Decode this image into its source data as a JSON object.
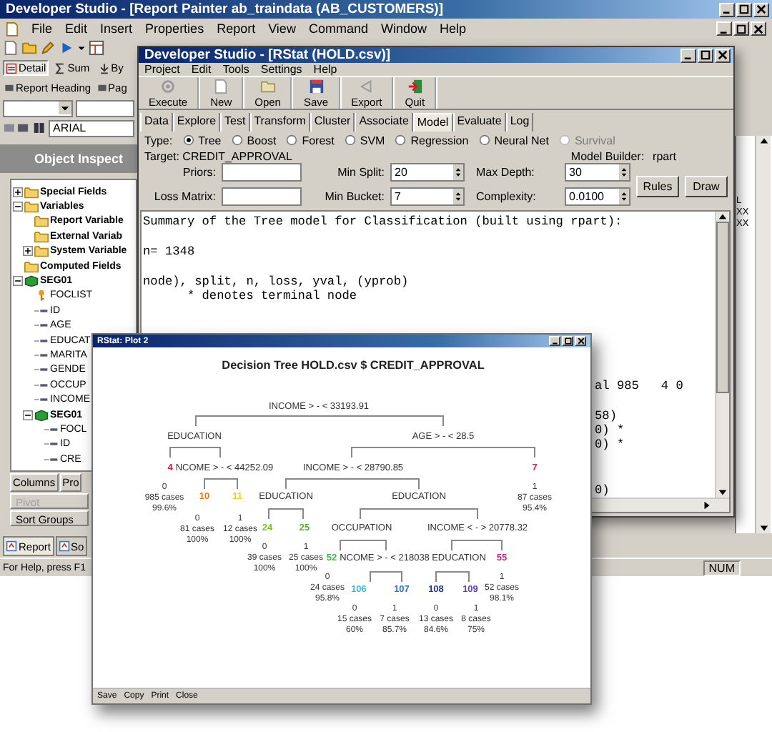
{
  "main_window": {
    "title": "Developer Studio - [Report Painter ab_traindata (AB_CUSTOMERS)]",
    "menu": [
      "File",
      "Edit",
      "Insert",
      "Properties",
      "Report",
      "View",
      "Command",
      "Window",
      "Help"
    ],
    "view_tabs": [
      {
        "label": "Detail",
        "kind": "detail",
        "selected": true
      },
      {
        "label": "Sum",
        "kind": "sum",
        "selected": false
      },
      {
        "label": "By",
        "kind": "by",
        "selected": false
      }
    ],
    "heading_buttons": [
      "Report Heading",
      "Pag"
    ],
    "font_field": {
      "value": "ARIAL"
    },
    "inspector": {
      "title": "Object Inspect",
      "tree": [
        {
          "label": "Special Fields",
          "kind": "folder",
          "expanded": false
        },
        {
          "label": "Variables",
          "kind": "folder",
          "expanded": true,
          "children": [
            {
              "label": "Report Variable",
              "kind": "folder"
            },
            {
              "label": "External Variab",
              "kind": "folder"
            },
            {
              "label": "System Variable",
              "kind": "folder",
              "expanded": false
            }
          ]
        },
        {
          "label": "Computed Fields",
          "kind": "folder"
        },
        {
          "label": "SEG01",
          "kind": "segment",
          "expanded": true,
          "children": [
            {
              "label": "FOCLIST",
              "kind": "key"
            },
            {
              "label": "ID",
              "kind": "field"
            },
            {
              "label": "AGE",
              "kind": "field"
            },
            {
              "label": "EDUCAT",
              "kind": "field"
            },
            {
              "label": "MARITA",
              "kind": "field"
            },
            {
              "label": "GENDE",
              "kind": "field"
            },
            {
              "label": "OCCUP",
              "kind": "field"
            },
            {
              "label": "INCOME",
              "kind": "field"
            },
            {
              "label": "SEG01",
              "kind": "segment",
              "expanded": true,
              "children": [
                {
                  "label": "FOCL",
                  "kind": "field"
                },
                {
                  "label": "ID",
                  "kind": "field"
                },
                {
                  "label": "CRE",
                  "kind": "field"
                }
              ]
            }
          ]
        }
      ]
    },
    "panel_tabs": [
      {
        "label": "Columns",
        "disabled": false
      },
      {
        "label": "Pro",
        "disabled": false
      },
      {
        "label": "Pivot",
        "disabled": true
      },
      {
        "label": "Sort Groups",
        "disabled": false
      }
    ],
    "bottom_tabs": [
      {
        "label": "Report",
        "selected": true
      },
      {
        "label": "So",
        "selected": false
      }
    ],
    "side_pane": {
      "lines": [
        "L",
        "XX",
        "XX"
      ]
    },
    "status_bar": {
      "message": "For Help, press F1",
      "indicator": "NUM"
    }
  },
  "rstat_window": {
    "title": "Developer Studio - [RStat (HOLD.csv)]",
    "menu": [
      "Project",
      "Edit",
      "Tools",
      "Settings",
      "Help"
    ],
    "toolbar": [
      {
        "label": "Execute",
        "kind": "execute"
      },
      {
        "label": "New",
        "kind": "new"
      },
      {
        "label": "Open",
        "kind": "open"
      },
      {
        "label": "Save",
        "kind": "save"
      },
      {
        "label": "Export",
        "kind": "export"
      },
      {
        "label": "Quit",
        "kind": "quit"
      }
    ],
    "tabs": [
      {
        "label": "Data",
        "selected": false
      },
      {
        "label": "Explore",
        "selected": false
      },
      {
        "label": "Test",
        "selected": false
      },
      {
        "label": "Transform",
        "selected": false
      },
      {
        "label": "Cluster",
        "selected": false
      },
      {
        "label": "Associate",
        "selected": false
      },
      {
        "label": "Model",
        "selected": true
      },
      {
        "label": "Evaluate",
        "selected": false
      },
      {
        "label": "Log",
        "selected": false
      }
    ],
    "type_label": "Type:",
    "types": [
      {
        "label": "Tree",
        "selected": true,
        "disabled": false
      },
      {
        "label": "Boost",
        "selected": false,
        "disabled": false
      },
      {
        "label": "Forest",
        "selected": false,
        "disabled": false
      },
      {
        "label": "SVM",
        "selected": false,
        "disabled": false
      },
      {
        "label": "Regression",
        "selected": false,
        "disabled": false
      },
      {
        "label": "Neural Net",
        "selected": false,
        "disabled": false
      },
      {
        "label": "Survival",
        "selected": false,
        "disabled": true
      }
    ],
    "target": "Target: CREDIT_APPROVAL",
    "model_builder_label": "Model Builder:",
    "model_builder": "rpart",
    "priors": {
      "label": "Priors:"
    },
    "loss_matrix": {
      "label": "Loss Matrix:"
    },
    "min_split": {
      "label": "Min Split:",
      "value": "20"
    },
    "max_depth": {
      "label": "Max Depth:",
      "value": "30"
    },
    "min_bucket": {
      "label": "Min Bucket:",
      "value": "7"
    },
    "complexity": {
      "label": "Complexity:",
      "value": "0.0100"
    },
    "buttons": [
      "Rules",
      "Draw"
    ],
    "output": {
      "paragraphs": [
        [
          "Summary of the Tree model for Classification (built using rpart):"
        ],
        [
          "n= 1348"
        ],
        [
          "node), split, n, loss, yval, (yprob)",
          "      * denotes terminal node"
        ]
      ],
      "partial_blocks": [
        [
          "al 985   4 0"
        ],
        [
          "58)",
          "0) *",
          "0) *"
        ],
        [
          "0)"
        ]
      ]
    }
  },
  "plot_window": {
    "title": "RStat: Plot 2",
    "chart_title": "Decision Tree HOLD.csv $ CREDIT_APPROVAL",
    "nodes": [
      {
        "kind": "split",
        "text": "INCOME > - < 33193.91"
      },
      {
        "kind": "split",
        "text": "EDUCATION"
      },
      {
        "kind": "split",
        "text": "AGE > - < 28.5"
      },
      {
        "kind": "number",
        "text": "4",
        "color": "#c8202c"
      },
      {
        "kind": "split",
        "text": "NCOME > - < 44252.09"
      },
      {
        "kind": "split",
        "text": "INCOME > - < 28790.85"
      },
      {
        "kind": "number",
        "text": "7",
        "color": "#c82860"
      },
      {
        "kind": "leaf",
        "lines": [
          "0",
          "985 cases",
          "99.6%"
        ]
      },
      {
        "kind": "number",
        "text": "10",
        "color": "#f07818"
      },
      {
        "kind": "number",
        "text": "11",
        "color": "#e8d020"
      },
      {
        "kind": "split",
        "text": "EDUCATION"
      },
      {
        "kind": "split",
        "text": "EDUCATION"
      },
      {
        "kind": "leaf",
        "lines": [
          "1",
          "87 cases",
          "95.4%"
        ]
      },
      {
        "kind": "leaf",
        "lines": [
          "0",
          "81 cases",
          "100%"
        ]
      },
      {
        "kind": "leaf",
        "lines": [
          "1",
          "12 cases",
          "100%"
        ]
      },
      {
        "kind": "number",
        "text": "24",
        "color": "#78c030"
      },
      {
        "kind": "number",
        "text": "25",
        "color": "#58b030"
      },
      {
        "kind": "split",
        "text": "OCCUPATION"
      },
      {
        "kind": "split",
        "text": "INCOME < - > 20778.32"
      },
      {
        "kind": "leaf",
        "lines": [
          "0",
          "39 cases",
          "100%"
        ]
      },
      {
        "kind": "leaf",
        "lines": [
          "1",
          "25 cases",
          "100%"
        ]
      },
      {
        "kind": "number",
        "text": "52",
        "color": "#40b048"
      },
      {
        "kind": "split",
        "text": "NCOME > - < 218038"
      },
      {
        "kind": "split",
        "text": "EDUCATION"
      },
      {
        "kind": "number",
        "text": "55",
        "color": "#c02888"
      },
      {
        "kind": "leaf",
        "lines": [
          "0",
          "24 cases",
          "95.8%"
        ]
      },
      {
        "kind": "number",
        "text": "106",
        "color": "#40b8d8"
      },
      {
        "kind": "number",
        "text": "107",
        "color": "#3070c8"
      },
      {
        "kind": "number",
        "text": "108",
        "color": "#203890"
      },
      {
        "kind": "number",
        "text": "109",
        "color": "#6840a8"
      },
      {
        "kind": "leaf",
        "lines": [
          "1",
          "52 cases",
          "98.1%"
        ]
      },
      {
        "kind": "leaf",
        "lines": [
          "0",
          "15 cases",
          "60%"
        ]
      },
      {
        "kind": "leaf",
        "lines": [
          "1",
          "7 cases",
          "85.7%"
        ]
      },
      {
        "kind": "leaf",
        "lines": [
          "0",
          "13 cases",
          "84.6%"
        ]
      },
      {
        "kind": "leaf",
        "lines": [
          "1",
          "8 cases",
          "75%"
        ]
      }
    ],
    "buttons": [
      "Save",
      "Copy",
      "Print",
      "Close"
    ]
  }
}
